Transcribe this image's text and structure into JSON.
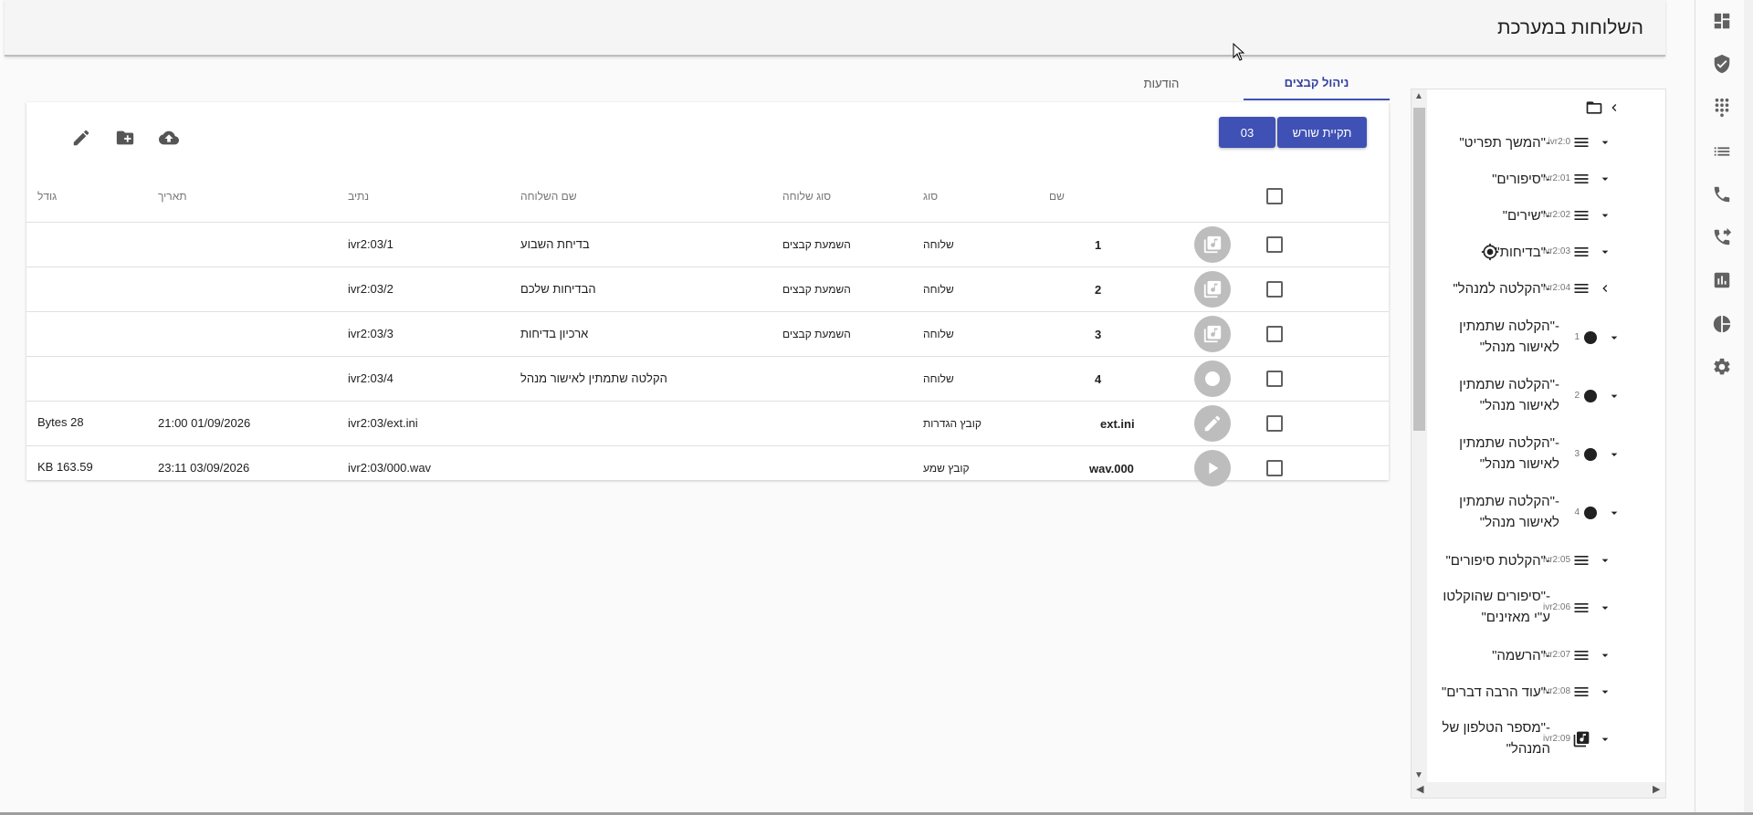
{
  "header": {
    "title": "השלוחות במערכת"
  },
  "tabs": [
    {
      "label": "ניהול קבצים",
      "active": true
    },
    {
      "label": "הודעות",
      "active": false
    }
  ],
  "toolbar": {
    "root_label": "תקיית שורש",
    "folder_label": "03"
  },
  "table": {
    "headers": {
      "name": "שם",
      "type": "סוג",
      "ext_type": "סוג שלוחה",
      "ext_name": "שם השלוחה",
      "path": "נתיב",
      "date": "תאריך",
      "size": "גודל"
    },
    "rows": [
      {
        "icon": "audio-file-icon",
        "name": "1",
        "type": "שלוחה",
        "ext_type": "השמעת קבצים",
        "ext_name": "בדיחת השבוע",
        "path": "ivr2:03/1",
        "date": "",
        "size": ""
      },
      {
        "icon": "audio-file-icon",
        "name": "2",
        "type": "שלוחה",
        "ext_type": "השמעת קבצים",
        "ext_name": "הבדיחות שלכם",
        "path": "ivr2:03/2",
        "date": "",
        "size": ""
      },
      {
        "icon": "audio-file-icon",
        "name": "3",
        "type": "שלוחה",
        "ext_type": "השמעת קבצים",
        "ext_name": "ארכיון בדיחות",
        "path": "ivr2:03/3",
        "date": "",
        "size": ""
      },
      {
        "icon": "record-icon",
        "name": "4",
        "type": "שלוחה",
        "ext_type": "",
        "ext_name": "הקלטה שתמתין לאישור מנהל",
        "path": "ivr2:03/4",
        "date": "",
        "size": ""
      },
      {
        "icon": "edit-icon",
        "name": "ext.ini",
        "type": "קובץ הגדרות",
        "ext_type": "",
        "ext_name": "",
        "path": "ivr2:03/ext.ini",
        "date": "21:00 01/09/2026",
        "size": "Bytes 28"
      },
      {
        "icon": "play-icon",
        "name": "wav.000",
        "type": "קובץ שמע",
        "ext_type": "",
        "ext_name": "",
        "path": "ivr2:03/000.wav",
        "date": "23:11 03/09/2026",
        "size": "KB 163.59"
      }
    ]
  },
  "tree": [
    {
      "code": "ivr2:0",
      "label": "-\"המשך תפריט\"",
      "icon": "menu-icon"
    },
    {
      "code": "ivr2:01",
      "label": "-\"סיפורים\"",
      "icon": "menu-icon"
    },
    {
      "code": "ivr2:02",
      "label": "-\"שירים\"",
      "icon": "menu-icon"
    },
    {
      "code": "ivr2:03",
      "label": "-\"בדיחות\"",
      "icon": "menu-icon"
    },
    {
      "code": "ivr2:04",
      "label": "-\"הקלטה למנהל\"",
      "icon": "menu-icon"
    },
    {
      "code": "1",
      "label": "-\"הקלטה שתמתין לאישור מנהל\"",
      "icon": "dot-icon"
    },
    {
      "code": "2",
      "label": "-\"הקלטה שתמתין לאישור מנהל\"",
      "icon": "dot-icon"
    },
    {
      "code": "3",
      "label": "-\"הקלטה שתמתין לאישור מנהל\"",
      "icon": "dot-icon"
    },
    {
      "code": "4",
      "label": "-\"הקלטה שתמתין לאישור מנהל\"",
      "icon": "dot-icon"
    },
    {
      "code": "ivr2:05",
      "label": "-\"הקלטת סיפורים\"",
      "icon": "menu-icon"
    },
    {
      "code": "ivr2:06",
      "label": "-\"סיפורים שהוקלטו ע\"י מאזינים\"",
      "icon": "menu-icon"
    },
    {
      "code": "ivr2:07",
      "label": "-\"הרשמה\"",
      "icon": "menu-icon"
    },
    {
      "code": "ivr2:08",
      "label": "-\"עוד הרבה דברים\"",
      "icon": "menu-icon"
    },
    {
      "code": "ivr2:09",
      "label": "-\"מספר הטלפון של המנהל\"",
      "icon": "audio-file-icon"
    }
  ],
  "colors": {
    "primary": "#3f51b5",
    "avatar": "#bdbdbd"
  }
}
